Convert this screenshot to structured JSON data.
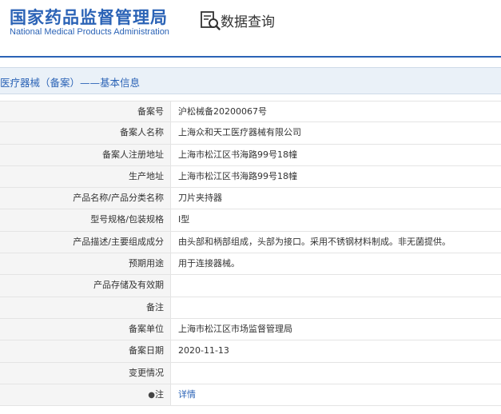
{
  "header": {
    "logo_cn": "国家药品监督管理局",
    "logo_en": "National Medical Products Administration",
    "query_title": "数据查询"
  },
  "section": {
    "title": "医疗器械（备案）——基本信息"
  },
  "rows": [
    {
      "label": "备案号",
      "value": "沪松械备20200067号"
    },
    {
      "label": "备案人名称",
      "value": "上海众和天工医疗器械有限公司"
    },
    {
      "label": "备案人注册地址",
      "value": "上海市松江区书海路99号18幢"
    },
    {
      "label": "生产地址",
      "value": "上海市松江区书海路99号18幢"
    },
    {
      "label": "产品名称/产品分类名称",
      "value": "刀片夹持器"
    },
    {
      "label": "型号规格/包装规格",
      "value": "I型"
    },
    {
      "label": "产品描述/主要组成成分",
      "value": "由头部和柄部组成，头部为接口。采用不锈钢材料制成。非无菌提供。"
    },
    {
      "label": "预期用途",
      "value": "用于连接器械。"
    },
    {
      "label": "产品存储及有效期",
      "value": ""
    },
    {
      "label": "备注",
      "value": ""
    },
    {
      "label": "备案单位",
      "value": "上海市松江区市场监督管理局"
    },
    {
      "label": "备案日期",
      "value": "2020-11-13"
    },
    {
      "label": "变更情况",
      "value": ""
    },
    {
      "label": "注",
      "value": "详情"
    }
  ],
  "icons": {
    "query": "search-document-icon",
    "note": "pin-icon"
  }
}
